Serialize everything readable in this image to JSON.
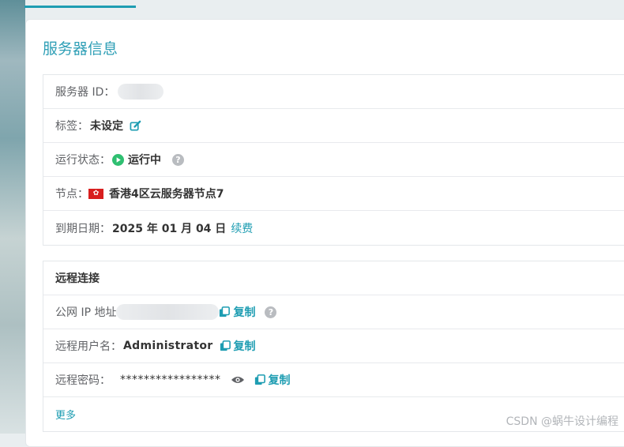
{
  "section_title": "服务器信息",
  "server_info": {
    "server_id_label": "服务器 ID：",
    "tag_label": "标签：",
    "tag_value": "未设定",
    "status_label": "运行状态：",
    "status_value": "运行中",
    "node_label": "节点：",
    "node_value": "香港4区云服务器节点7",
    "expiry_label": "到期日期：",
    "expiry_value": "2025 年 01 月 04 日",
    "renew_link": "续费"
  },
  "remote": {
    "header": "远程连接",
    "ip_label": "公网 IP 地址",
    "copy_label": "复制",
    "username_label": "远程用户名：",
    "username_value": "Administrator",
    "password_label": "远程密码：",
    "password_value": "*****************",
    "more_link": "更多"
  },
  "watermark": "CSDN @蜗牛设计编程",
  "colors": {
    "accent": "#1e9db2",
    "status_green": "#2fbf71",
    "flag_red": "#d81e1e"
  },
  "icons": [
    "edit-icon",
    "play-status-icon",
    "help-icon",
    "hk-flag-icon",
    "copy-icon",
    "eye-icon"
  ]
}
